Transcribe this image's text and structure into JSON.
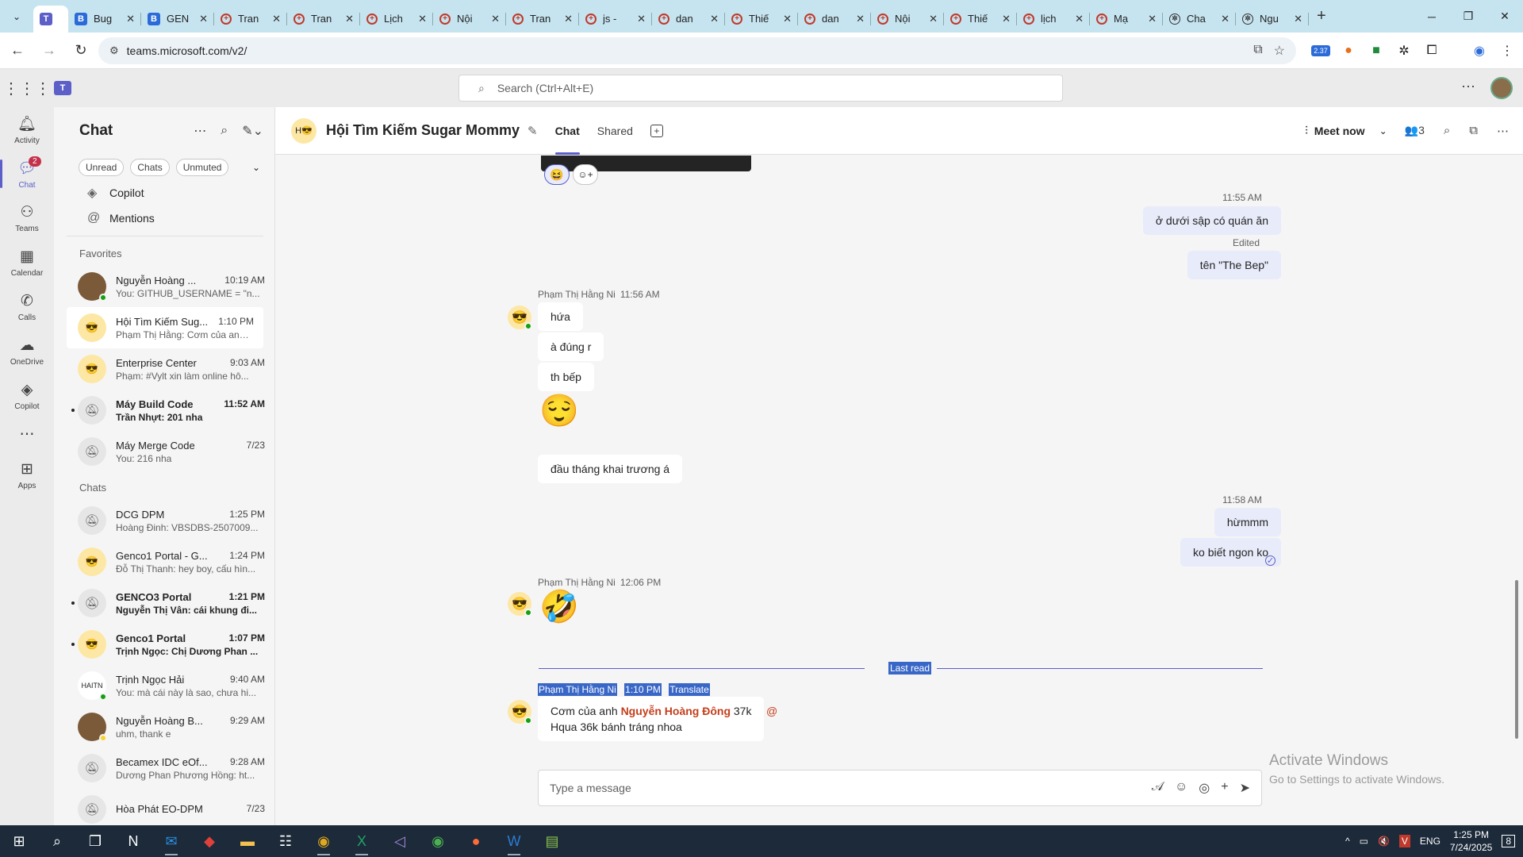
{
  "browser": {
    "tabs": [
      {
        "title": "",
        "icon": "teams-icon",
        "active": true
      },
      {
        "title": "Bug",
        "icon": "ms-icon"
      },
      {
        "title": "GEN",
        "icon": "ms-icon"
      },
      {
        "title": "Tran",
        "icon": "plus-circle-icon"
      },
      {
        "title": "Tran",
        "icon": "plus-circle-icon"
      },
      {
        "title": "Lịch",
        "icon": "plus-circle-icon"
      },
      {
        "title": "Nội",
        "icon": "plus-circle-icon"
      },
      {
        "title": "Tran",
        "icon": "plus-circle-icon"
      },
      {
        "title": "js -",
        "icon": "plus-circle-icon"
      },
      {
        "title": "dan",
        "icon": "plus-circle-icon"
      },
      {
        "title": "Thiế",
        "icon": "plus-circle-icon"
      },
      {
        "title": "dan",
        "icon": "plus-circle-icon"
      },
      {
        "title": "Nội",
        "icon": "plus-circle-icon"
      },
      {
        "title": "Thiế",
        "icon": "plus-circle-icon"
      },
      {
        "title": "lịch",
        "icon": "plus-circle-icon"
      },
      {
        "title": "Mạ",
        "icon": "plus-circle-icon"
      },
      {
        "title": "Cha",
        "icon": "openai-icon"
      },
      {
        "title": "Ngu",
        "icon": "openai-icon"
      }
    ],
    "url": "teams.microsoft.com/v2/",
    "ext_badge": "2.37"
  },
  "teams": {
    "search_placeholder": "Search (Ctrl+Alt+E)"
  },
  "rail": [
    {
      "label": "Activity",
      "icon": "bell-icon"
    },
    {
      "label": "Chat",
      "icon": "chat-icon",
      "badge": "2",
      "active": true
    },
    {
      "label": "Teams",
      "icon": "teams-people-icon"
    },
    {
      "label": "Calendar",
      "icon": "calendar-icon"
    },
    {
      "label": "Calls",
      "icon": "phone-icon"
    },
    {
      "label": "OneDrive",
      "icon": "cloud-icon"
    },
    {
      "label": "Copilot",
      "icon": "copilot-icon"
    },
    {
      "label": "",
      "icon": "more-icon"
    },
    {
      "label": "Apps",
      "icon": "apps-icon"
    }
  ],
  "chatlist": {
    "title": "Chat",
    "filters": [
      "Unread",
      "Chats",
      "Unmuted"
    ],
    "pinned": [
      {
        "label": "Copilot",
        "icon": "copilot-icon"
      },
      {
        "label": "Mentions",
        "icon": "at-icon"
      }
    ],
    "favorites_label": "Favorites",
    "favorites": [
      {
        "name": "Nguyễn Hoàng ...",
        "time": "10:19 AM",
        "preview": "You: GITHUB_USERNAME = \"n...",
        "avatar": "photo"
      },
      {
        "name": "Hội Tìm Kiếm Sug...",
        "time": "1:10 PM",
        "preview": "Phạm Thị Hằng: Cơm của anh ...",
        "avatar": "group",
        "selected": true
      },
      {
        "name": "Enterprise Center",
        "time": "9:03 AM",
        "preview": "Phạm: #Vylt xin làm online hô...",
        "avatar": "group"
      },
      {
        "name": "Máy Build Code",
        "time": "11:52 AM",
        "preview": "Trần Nhựt: 201 nha",
        "avatar": "muted",
        "bold": true
      },
      {
        "name": "Máy Merge Code",
        "time": "7/23",
        "preview": "You: 216  nha",
        "avatar": "muted"
      }
    ],
    "chats_label": "Chats",
    "chats": [
      {
        "name": "DCG DPM",
        "time": "1:25 PM",
        "preview": "Hoàng Đinh: VBSDBS-2507009...",
        "avatar": "muted"
      },
      {
        "name": "Genco1 Portal - G...",
        "time": "1:24 PM",
        "preview": "Đỗ Thị Thanh: hey boy, cấu hìn...",
        "avatar": "group"
      },
      {
        "name": "GENCO3 Portal",
        "time": "1:21 PM",
        "preview": "Nguyễn Thị Vân: cái khung đi...",
        "avatar": "muted",
        "bold": true
      },
      {
        "name": "Genco1 Portal",
        "time": "1:07 PM",
        "preview": "Trịnh Ngọc: Chị Dương Phan ...",
        "avatar": "group",
        "bold": true
      },
      {
        "name": "Trịnh Ngọc Hải",
        "time": "9:40 AM",
        "preview": "You: mà cái này là sao, chưa hi...",
        "avatar": "logo"
      },
      {
        "name": "Nguyễn Hoàng B...",
        "time": "9:29 AM",
        "preview": "uhm, thank e",
        "avatar": "photo"
      },
      {
        "name": "Becamex IDC eOf...",
        "time": "9:28 AM",
        "preview": "Dương Phan Phương Hồng: ht...",
        "avatar": "muted"
      },
      {
        "name": "Hòa Phát EO-DPM",
        "time": "7/23",
        "preview": "",
        "avatar": "muted"
      }
    ]
  },
  "conversation": {
    "title": "Hội Tìm Kiếm Sugar Mommy",
    "tabs": [
      "Chat",
      "Shared"
    ],
    "meet_label": "Meet now",
    "participants": "3",
    "messages": {
      "t1": "11:55 AM",
      "m1": "ở dưới sập có quán ăn",
      "edited": "Edited",
      "m2": "tên \"The Bep\"",
      "s1_name": "Phạm Thị Hằng Ni",
      "s1_time": "11:56 AM",
      "m3": "hứa",
      "m4": "à đúng r",
      "m5": "th bếp",
      "m6_emoji": "😌",
      "m7": "đầu tháng khai trương á",
      "t2": "11:58 AM",
      "m8": "hừmmm",
      "m9": "ko biết ngon ko",
      "s2_name": "Phạm Thị Hằng Ni",
      "s2_time": "12:06 PM",
      "m10_emoji": "🤣",
      "last_read": "Last read",
      "s3_name": "Phạm Thị Hằng Ni",
      "s3_time": "1:10 PM",
      "translate": "Translate",
      "m11_a": "Cơm của anh ",
      "m11_mention": "Nguyễn Hoàng Đông",
      "m11_b": " 37k",
      "m11_line2": "Hqua 36k bánh tráng nhoa",
      "reaction": "😆"
    },
    "compose_placeholder": "Type a message"
  },
  "watermark": {
    "line1": "Activate Windows",
    "line2": "Go to Settings to activate Windows."
  },
  "taskbar": {
    "lang": "ENG",
    "time": "1:25 PM",
    "date": "7/24/2025",
    "notif": "8"
  }
}
